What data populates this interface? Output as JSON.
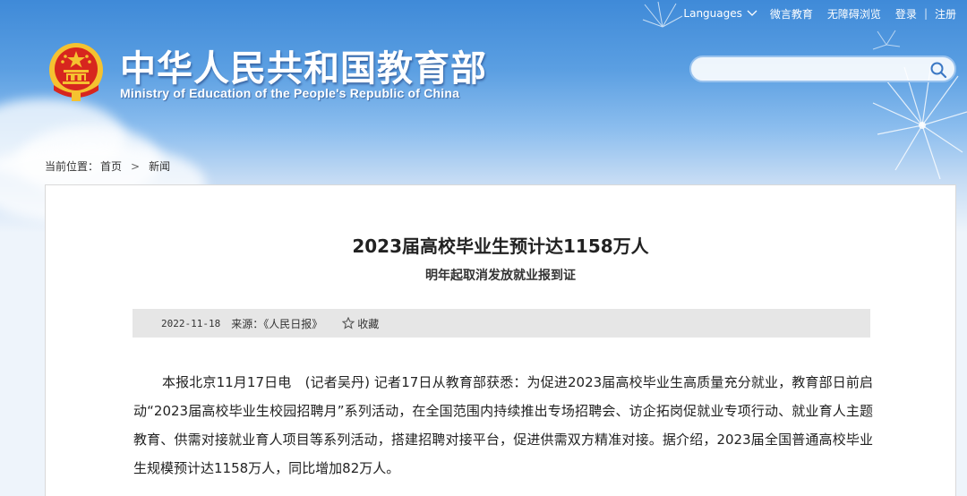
{
  "header": {
    "top_links": {
      "languages": "Languages",
      "weixin": "微言教育",
      "accessible": "无障碍浏览",
      "login": "登录",
      "register": "注册",
      "separator": "|"
    },
    "site_title_cn": "中华人民共和国教育部",
    "site_title_en": "Ministry of Education of the People's Republic of China",
    "search": {
      "value": "",
      "placeholder": ""
    }
  },
  "breadcrumb": {
    "label": "当前位置：",
    "home": "首页",
    "separator": ">",
    "current": "新闻"
  },
  "article": {
    "title": "2023届高校毕业生预计达1158万人",
    "subtitle": "明年起取消发放就业报到证",
    "date": "2022-11-18",
    "source": "来源：《人民日报》",
    "favorite": "收藏",
    "body": "本报北京11月17日电　(记者吴丹) 记者17日从教育部获悉：为促进2023届高校毕业生高质量充分就业，教育部日前启动“2023届高校毕业生校园招聘月”系列活动，在全国范围内持续推出专场招聘会、访企拓岗促就业专项行动、就业育人主题教育、供需对接就业育人项目等系列活动，搭建招聘对接平台，促进供需双方精准对接。据介绍，2023届全国普通高校毕业生规模预计达1158万人，同比增加82万人。"
  },
  "colors": {
    "header_blue": "#3f8ad8",
    "emblem_red": "#d7261e",
    "emblem_gold": "#f5c230",
    "meta_bar": "#e6e6e6"
  },
  "icons": {
    "search": "search-icon",
    "chevron": "chevron-down-icon",
    "star": "star-icon",
    "emblem": "national-emblem-icon"
  }
}
